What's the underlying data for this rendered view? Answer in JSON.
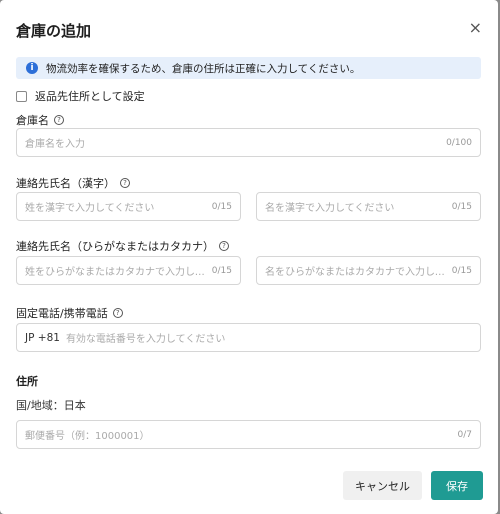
{
  "dialog": {
    "title": "倉庫の追加",
    "close": "×",
    "info": "物流効率を確保するため、倉庫の住所は正確に入力してください。",
    "return_checkbox_label": "返品先住所として設定"
  },
  "warehouse_name": {
    "label": "倉庫名",
    "placeholder": "倉庫名を入力",
    "count": "0/100"
  },
  "contact_kanji": {
    "label": "連絡先氏名（漢字）",
    "last_placeholder": "姓を漢字で入力してください",
    "last_count": "0/15",
    "first_placeholder": "名を漢字で入力してください",
    "first_count": "0/15"
  },
  "contact_kana": {
    "label": "連絡先氏名（ひらがなまたはカタカナ）",
    "last_placeholder": "姓をひらがなまたはカタカナで入力してく…",
    "last_count": "0/15",
    "first_placeholder": "名をひらがなまたはカタカナで入力してく…",
    "first_count": "0/15"
  },
  "phone": {
    "label": "固定電話/携帯電話",
    "prefix": "JP +81",
    "placeholder": "有効な電話番号を入力してください"
  },
  "address": {
    "heading": "住所",
    "country": "国/地域：日本",
    "postal_placeholder": "郵便番号（例：1000001）",
    "postal_count": "0/7"
  },
  "buttons": {
    "cancel": "キャンセル",
    "save": "保存"
  },
  "colors": {
    "accent": "#1f9b93",
    "info_bg": "#e6effb",
    "info_icon": "#2d6fd8"
  }
}
